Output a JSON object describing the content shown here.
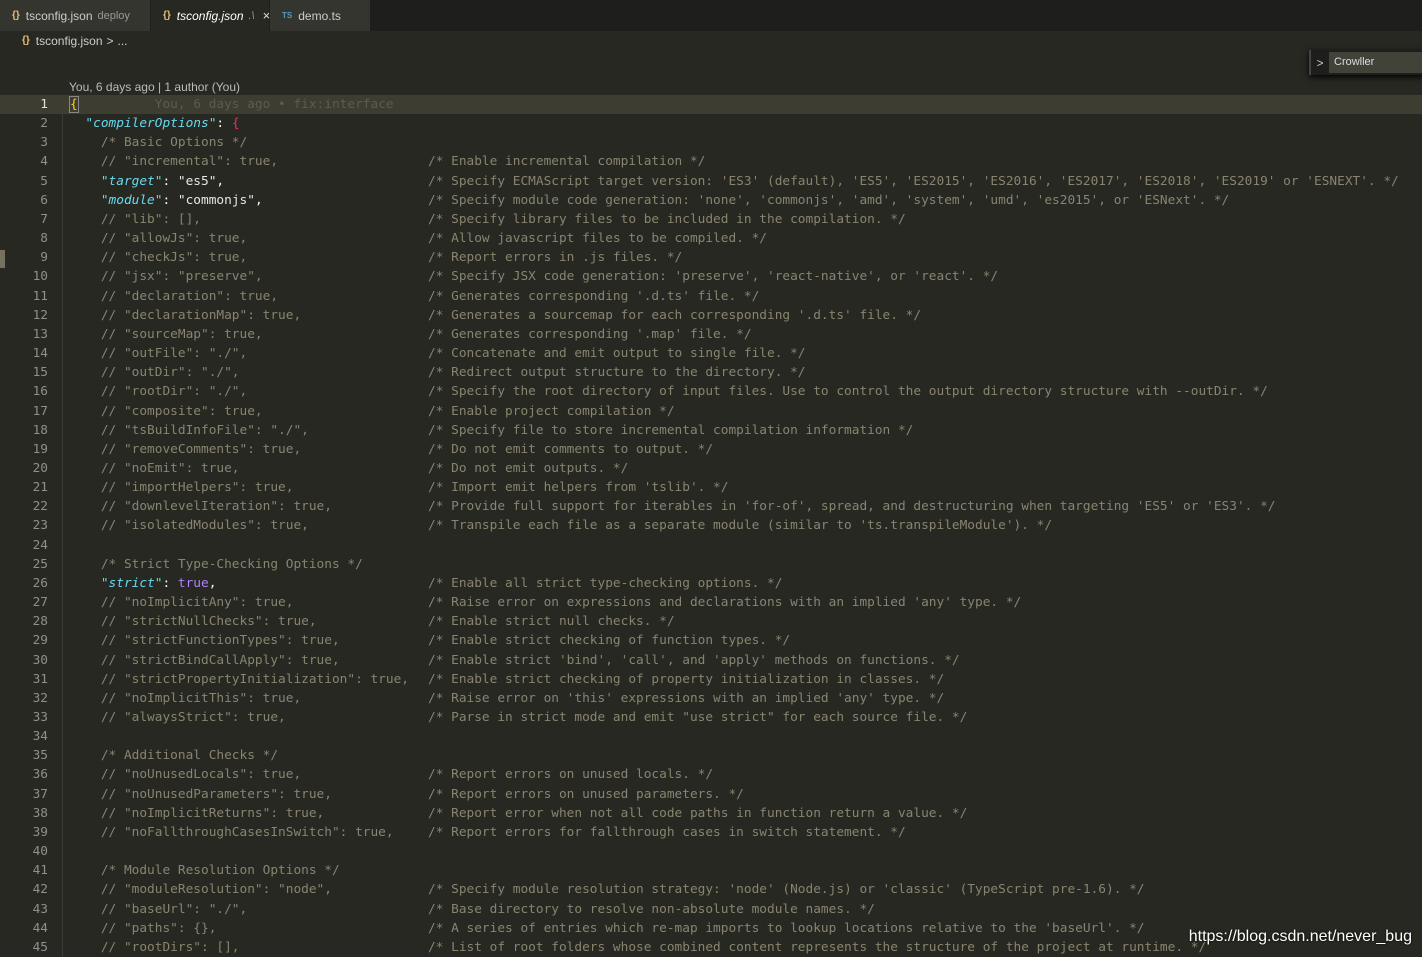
{
  "tabs": [
    {
      "icon": "json-braces-icon",
      "label": "tsconfig.json",
      "desc": "deploy",
      "active": false
    },
    {
      "icon": "json-braces-icon",
      "label": "tsconfig.json",
      "desc": ".\\",
      "active": true
    },
    {
      "icon": "ts-file-icon",
      "label": "demo.ts",
      "desc": "",
      "active": false
    }
  ],
  "tab_icons": {
    "json": "{}",
    "ts": "TS",
    "close": "×"
  },
  "breadcrumb": {
    "file": "tsconfig.json",
    "sep": ">",
    "rest": "..."
  },
  "find_widget": {
    "chevron": ">",
    "value": "Crowller"
  },
  "blame_header": "You, 6 days ago | 1 author (You)",
  "blame_inline": "You, 6 days ago • fix:interface",
  "watermark": "https://blog.csdn.net/never_bug",
  "colors": {
    "background": "#272822",
    "key": "#66d9ef",
    "comment": "#88846f",
    "boolean": "#ae81ff"
  },
  "lines": [
    {
      "n": "1",
      "type": "open",
      "text": "{"
    },
    {
      "n": "2",
      "type": "obj",
      "indent": "  ",
      "key": "\"compilerOptions\"",
      "text": "{"
    },
    {
      "n": "3",
      "type": "comment",
      "indent": "    ",
      "text": "/* Basic Options */"
    },
    {
      "n": "4",
      "type": "comment",
      "indent": "    ",
      "text": "// \"incremental\": true,",
      "note": "/* Enable incremental compilation */"
    },
    {
      "n": "5",
      "type": "prop",
      "indent": "    ",
      "key": "\"target\"",
      "value": "\"es5\"",
      "vtype": "s",
      "note": "/* Specify ECMAScript target version: 'ES3' (default), 'ES5', 'ES2015', 'ES2016', 'ES2017', 'ES2018', 'ES2019' or 'ESNEXT'. */"
    },
    {
      "n": "6",
      "type": "prop",
      "indent": "    ",
      "key": "\"module\"",
      "value": "\"commonjs\"",
      "vtype": "s",
      "note": "/* Specify module code generation: 'none', 'commonjs', 'amd', 'system', 'umd', 'es2015', or 'ESNext'. */"
    },
    {
      "n": "7",
      "type": "comment",
      "indent": "    ",
      "text": "// \"lib\": [],",
      "note": "/* Specify library files to be included in the compilation. */"
    },
    {
      "n": "8",
      "type": "comment",
      "indent": "    ",
      "text": "// \"allowJs\": true,",
      "note": "/* Allow javascript files to be compiled. */"
    },
    {
      "n": "9",
      "type": "comment",
      "indent": "    ",
      "text": "// \"checkJs\": true,",
      "note": "/* Report errors in .js files. */"
    },
    {
      "n": "10",
      "type": "comment",
      "indent": "    ",
      "text": "// \"jsx\": \"preserve\",",
      "note": "/* Specify JSX code generation: 'preserve', 'react-native', or 'react'. */"
    },
    {
      "n": "11",
      "type": "comment",
      "indent": "    ",
      "text": "// \"declaration\": true,",
      "note": "/* Generates corresponding '.d.ts' file. */"
    },
    {
      "n": "12",
      "type": "comment",
      "indent": "    ",
      "text": "// \"declarationMap\": true,",
      "note": "/* Generates a sourcemap for each corresponding '.d.ts' file. */"
    },
    {
      "n": "13",
      "type": "comment",
      "indent": "    ",
      "text": "// \"sourceMap\": true,",
      "note": "/* Generates corresponding '.map' file. */"
    },
    {
      "n": "14",
      "type": "comment",
      "indent": "    ",
      "text": "// \"outFile\": \"./\",",
      "note": "/* Concatenate and emit output to single file. */"
    },
    {
      "n": "15",
      "type": "comment",
      "indent": "    ",
      "text": "// \"outDir\": \"./\",",
      "note": "/* Redirect output structure to the directory. */"
    },
    {
      "n": "16",
      "type": "comment",
      "indent": "    ",
      "text": "// \"rootDir\": \"./\",",
      "note": "/* Specify the root directory of input files. Use to control the output directory structure with --outDir. */"
    },
    {
      "n": "17",
      "type": "comment",
      "indent": "    ",
      "text": "// \"composite\": true,",
      "note": "/* Enable project compilation */"
    },
    {
      "n": "18",
      "type": "comment",
      "indent": "    ",
      "text": "// \"tsBuildInfoFile\": \"./\",",
      "note": "/* Specify file to store incremental compilation information */"
    },
    {
      "n": "19",
      "type": "comment",
      "indent": "    ",
      "text": "// \"removeComments\": true,",
      "note": "/* Do not emit comments to output. */"
    },
    {
      "n": "20",
      "type": "comment",
      "indent": "    ",
      "text": "// \"noEmit\": true,",
      "note": "/* Do not emit outputs. */"
    },
    {
      "n": "21",
      "type": "comment",
      "indent": "    ",
      "text": "// \"importHelpers\": true,",
      "note": "/* Import emit helpers from 'tslib'. */"
    },
    {
      "n": "22",
      "type": "comment",
      "indent": "    ",
      "text": "// \"downlevelIteration\": true,",
      "note": "/* Provide full support for iterables in 'for-of', spread, and destructuring when targeting 'ES5' or 'ES3'. */"
    },
    {
      "n": "23",
      "type": "comment",
      "indent": "    ",
      "text": "// \"isolatedModules\": true,",
      "note": "/* Transpile each file as a separate module (similar to 'ts.transpileModule'). */"
    },
    {
      "n": "24",
      "type": "blank"
    },
    {
      "n": "25",
      "type": "comment",
      "indent": "    ",
      "text": "/* Strict Type-Checking Options */"
    },
    {
      "n": "26",
      "type": "prop",
      "indent": "    ",
      "key": "\"strict\"",
      "value": "true",
      "vtype": "b",
      "note": "/* Enable all strict type-checking options. */"
    },
    {
      "n": "27",
      "type": "comment",
      "indent": "    ",
      "text": "// \"noImplicitAny\": true,",
      "note": "/* Raise error on expressions and declarations with an implied 'any' type. */"
    },
    {
      "n": "28",
      "type": "comment",
      "indent": "    ",
      "text": "// \"strictNullChecks\": true,",
      "note": "/* Enable strict null checks. */"
    },
    {
      "n": "29",
      "type": "comment",
      "indent": "    ",
      "text": "// \"strictFunctionTypes\": true,",
      "note": "/* Enable strict checking of function types. */"
    },
    {
      "n": "30",
      "type": "comment",
      "indent": "    ",
      "text": "// \"strictBindCallApply\": true,",
      "note": "/* Enable strict 'bind', 'call', and 'apply' methods on functions. */"
    },
    {
      "n": "31",
      "type": "comment",
      "indent": "    ",
      "text": "// \"strictPropertyInitialization\": true,",
      "note": "/* Enable strict checking of property initialization in classes. */"
    },
    {
      "n": "32",
      "type": "comment",
      "indent": "    ",
      "text": "// \"noImplicitThis\": true,",
      "note": "/* Raise error on 'this' expressions with an implied 'any' type. */"
    },
    {
      "n": "33",
      "type": "comment",
      "indent": "    ",
      "text": "// \"alwaysStrict\": true,",
      "note": "/* Parse in strict mode and emit \"use strict\" for each source file. */"
    },
    {
      "n": "34",
      "type": "blank"
    },
    {
      "n": "35",
      "type": "comment",
      "indent": "    ",
      "text": "/* Additional Checks */"
    },
    {
      "n": "36",
      "type": "comment",
      "indent": "    ",
      "text": "// \"noUnusedLocals\": true,",
      "note": "/* Report errors on unused locals. */"
    },
    {
      "n": "37",
      "type": "comment",
      "indent": "    ",
      "text": "// \"noUnusedParameters\": true,",
      "note": "/* Report errors on unused parameters. */"
    },
    {
      "n": "38",
      "type": "comment",
      "indent": "    ",
      "text": "// \"noImplicitReturns\": true,",
      "note": "/* Report error when not all code paths in function return a value. */"
    },
    {
      "n": "39",
      "type": "comment",
      "indent": "    ",
      "text": "// \"noFallthroughCasesInSwitch\": true,",
      "note": "/* Report errors for fallthrough cases in switch statement. */"
    },
    {
      "n": "40",
      "type": "blank"
    },
    {
      "n": "41",
      "type": "comment",
      "indent": "    ",
      "text": "/* Module Resolution Options */"
    },
    {
      "n": "42",
      "type": "comment",
      "indent": "    ",
      "text": "// \"moduleResolution\": \"node\",",
      "note": "/* Specify module resolution strategy: 'node' (Node.js) or 'classic' (TypeScript pre-1.6). */"
    },
    {
      "n": "43",
      "type": "comment",
      "indent": "    ",
      "text": "// \"baseUrl\": \"./\",",
      "note": "/* Base directory to resolve non-absolute module names. */"
    },
    {
      "n": "44",
      "type": "comment",
      "indent": "    ",
      "text": "// \"paths\": {},",
      "note": "/* A series of entries which re-map imports to lookup locations relative to the 'baseUrl'. */"
    },
    {
      "n": "45",
      "type": "comment",
      "indent": "    ",
      "text": "// \"rootDirs\": [],",
      "note": "/* List of root folders whose combined content represents the structure of the project at runtime. */"
    }
  ]
}
